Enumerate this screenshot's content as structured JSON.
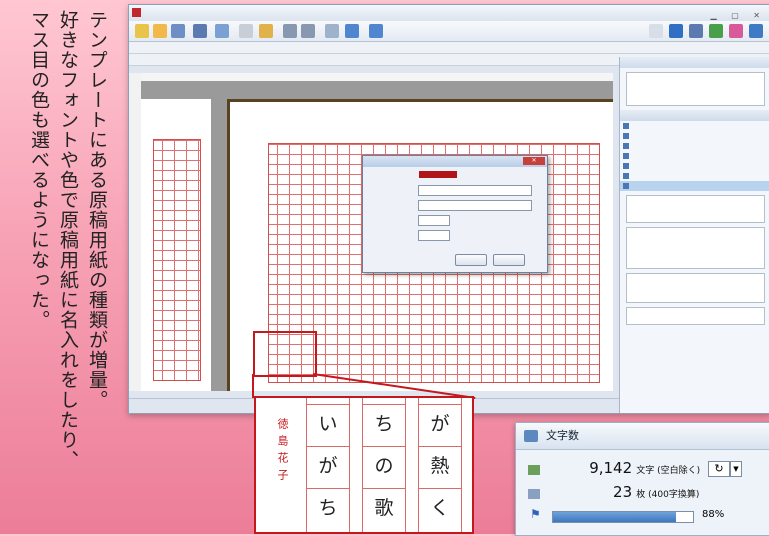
{
  "caption": {
    "lines": [
      "テンプレートにある原稿用紙の種類が増量。",
      "好きなフォントや色で原稿用紙に名入れをしたり、",
      "マス目の色も選べるようになった。"
    ]
  },
  "zoom": {
    "name_vertical": "徳島花子",
    "columns": [
      [
        "い",
        "が",
        "ち"
      ],
      [
        "ち",
        "の",
        "歌"
      ],
      [
        "が",
        "熱",
        "く"
      ]
    ]
  },
  "counter_panel": {
    "title": "文字数",
    "char_count": "9,142",
    "char_label": "文字 (空白除く)",
    "page_count": "23",
    "page_label": "枚 (400字換算)",
    "progress_fraction": 0.88,
    "progress_label": "88%"
  },
  "colors": {
    "accent_red": "#c5181d",
    "grid_red": "#e07070"
  }
}
